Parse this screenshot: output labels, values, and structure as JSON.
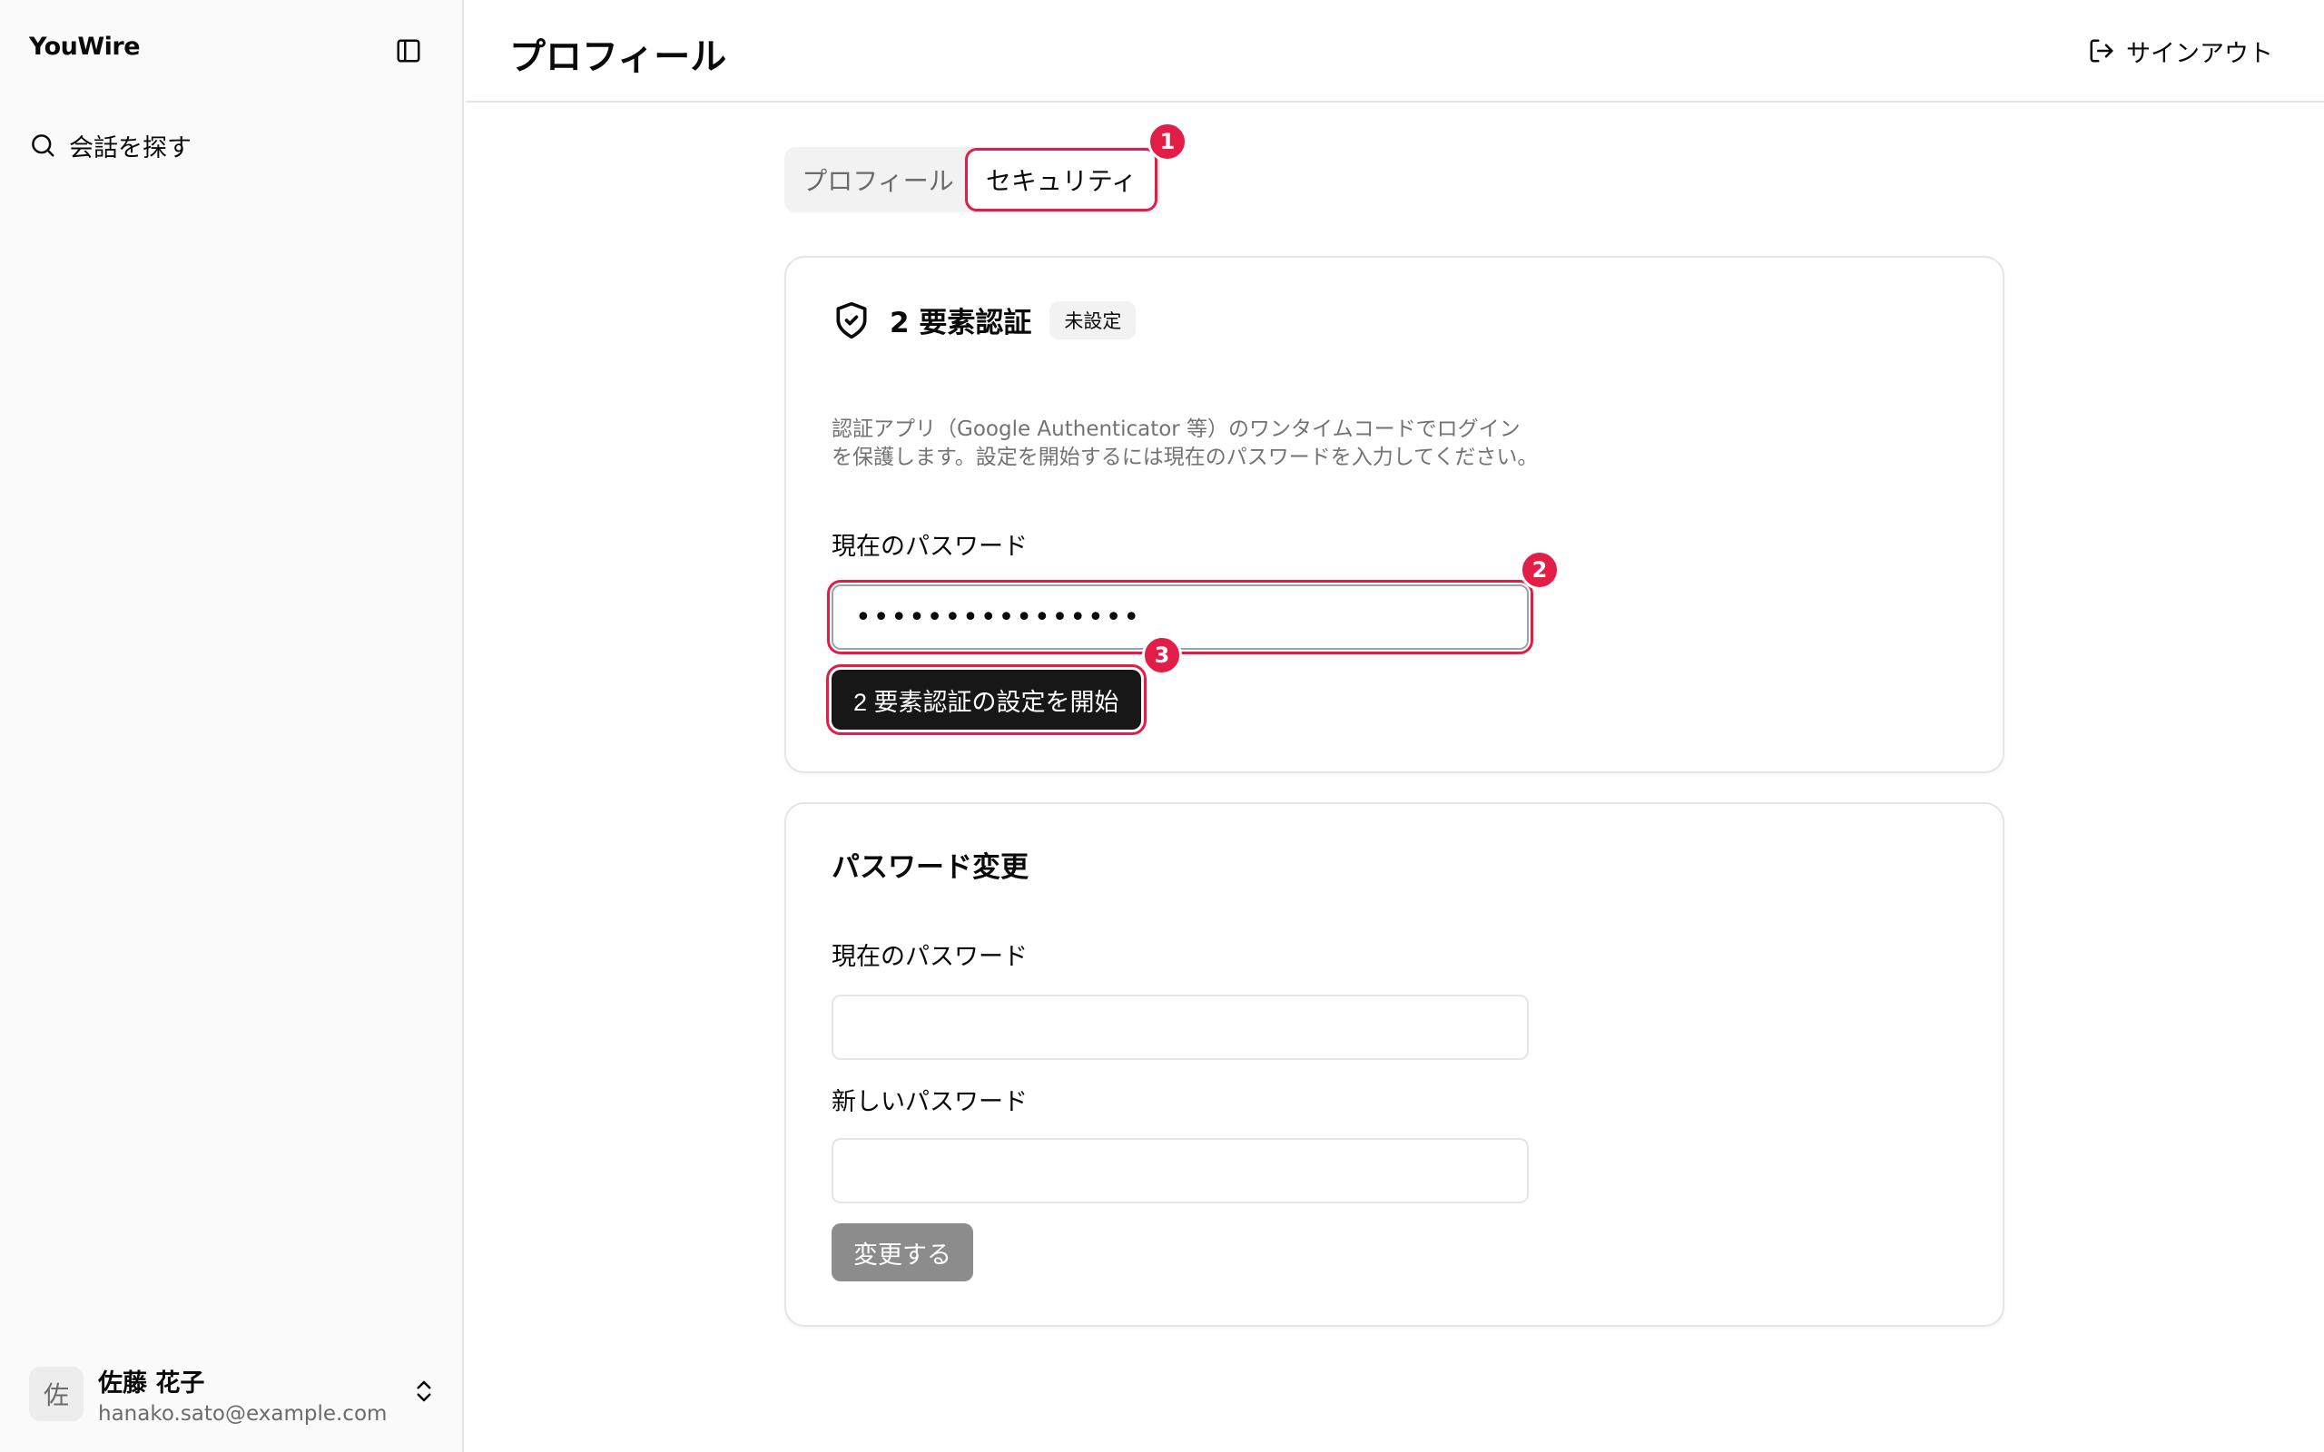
{
  "sidebar": {
    "brand": "YouWire",
    "nav": [
      {
        "label": "会話を探す",
        "icon": "search-icon"
      }
    ],
    "user": {
      "avatar_initial": "佐",
      "name": "佐藤 花子",
      "email": "hanako.sato@example.com"
    }
  },
  "header": {
    "title": "プロフィール",
    "signout_label": "サインアウト"
  },
  "tabs": [
    {
      "label": "プロフィール",
      "active": false
    },
    {
      "label": "セキュリティ",
      "active": true
    }
  ],
  "markers": [
    "1",
    "2",
    "3"
  ],
  "two_factor": {
    "title": "2 要素認証",
    "status": "未設定",
    "description": "認証アプリ（Google Authenticator 等）のワンタイムコードでログインを保護します。設定を開始するには現在のパスワードを入力してください。",
    "password_label": "現在のパスワード",
    "password_value": "••••••••••••••••",
    "start_button": "2 要素認証の設定を開始"
  },
  "password_change": {
    "title": "パスワード変更",
    "current_label": "現在のパスワード",
    "current_value": "",
    "new_label": "新しいパスワード",
    "new_value": "",
    "submit_button": "変更する"
  },
  "colors": {
    "accent_marker": "#e11d48",
    "primary_button": "#171717",
    "disabled_button": "#8c8c8c"
  }
}
